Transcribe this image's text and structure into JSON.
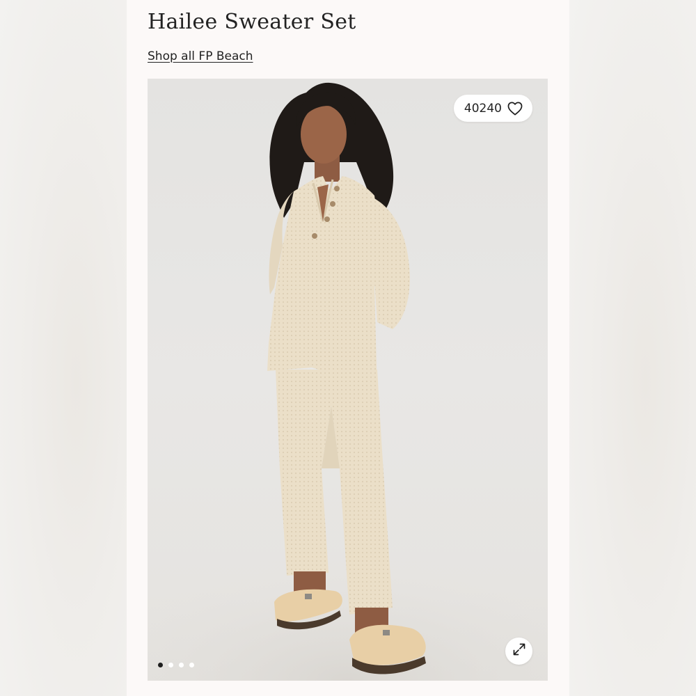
{
  "product": {
    "title": "Hailee Sweater Set",
    "shop_link_label": "Shop all FP Beach"
  },
  "gallery": {
    "favorite_count": "40240",
    "favorite_icon": "heart-outline-icon",
    "expand_icon": "expand-arrows-icon",
    "slide_count": 4,
    "active_slide": 1
  },
  "colors": {
    "card_background": "#fcf9f8",
    "text": "#222222",
    "garment": "#ebdfc8",
    "sandal": "#e8cfa6"
  }
}
